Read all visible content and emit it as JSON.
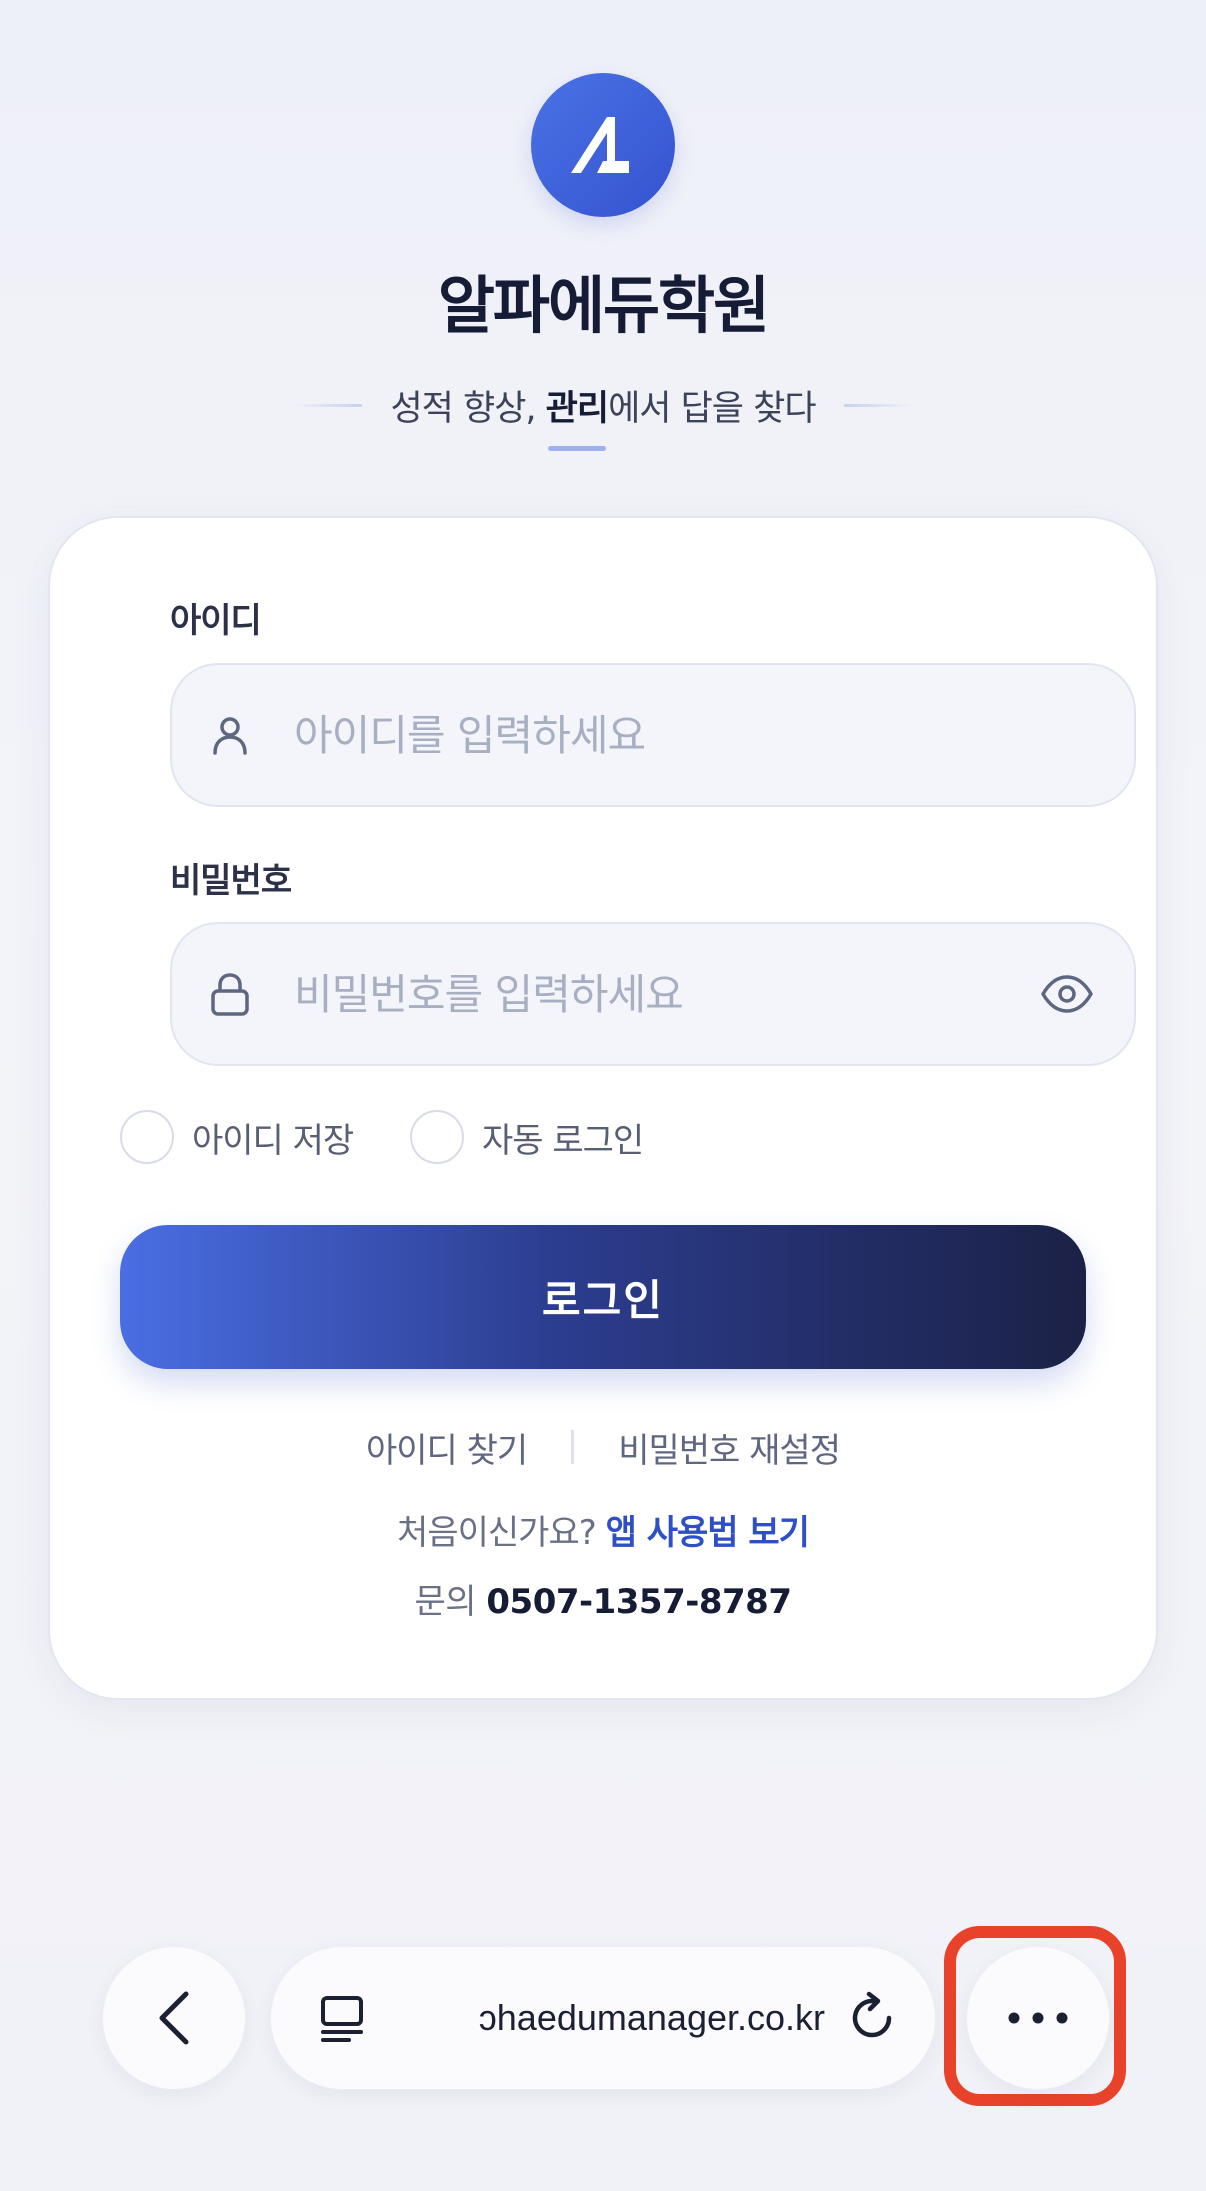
{
  "header": {
    "brand": "알파에듀학원",
    "tagline_pre": "성적 향상, ",
    "tagline_strong": "관리",
    "tagline_post": "에서 답을 찾다"
  },
  "form": {
    "id_label": "아이디",
    "id_placeholder": "아이디를 입력하세요",
    "password_label": "비밀번호",
    "password_placeholder": "비밀번호를 입력하세요",
    "save_id": "아이디 저장",
    "auto_login": "자동 로그인",
    "login_button": "로그인"
  },
  "links": {
    "find_id": "아이디 찾기",
    "reset_password": "비밀번호 재설정",
    "first_time": "처음이신가요?",
    "guide": "앱 사용법 보기",
    "contact_label": "문의",
    "phone": "0507-1357-8787"
  },
  "browser": {
    "url": "ɔhaedumanager.co.kr"
  },
  "colors": {
    "accent": "#3e63d9",
    "button_start": "#4a6ee3",
    "button_end": "#1b2146",
    "highlight": "#e8432a"
  }
}
